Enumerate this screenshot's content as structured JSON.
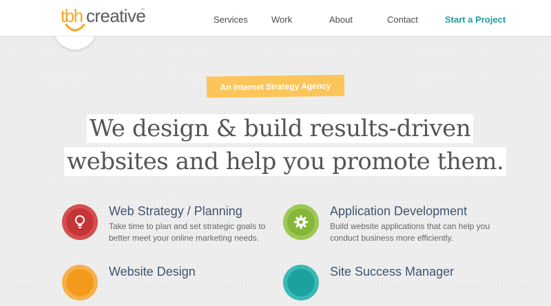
{
  "logo": {
    "prefix": "tbh",
    "name": "creative",
    "tm": "™"
  },
  "nav": {
    "items": [
      {
        "label": "Services"
      },
      {
        "label": "Work"
      },
      {
        "label": "About"
      },
      {
        "label": "Contact"
      }
    ],
    "cta": "Start a Project"
  },
  "hero": {
    "badge": "An Internet Strategy Agency",
    "headline_line1": "We design & build results-driven",
    "headline_line2": "websites and help you promote them."
  },
  "services": [
    {
      "title": "Web Strategy / Planning",
      "desc": "Take time to plan and set strategic goals to better meet your online marketing needs.",
      "icon": "lightbulb-icon",
      "color": "#c93a3a"
    },
    {
      "title": "Application Development",
      "desc": "Build website applications that can help you conduct business more efficiently.",
      "icon": "gear-icon",
      "color": "#8cbc3f"
    },
    {
      "title": "Website Design",
      "desc": "",
      "icon": "design-icon",
      "color": "#f5a124"
    },
    {
      "title": "Site Success Manager",
      "desc": "",
      "icon": "chart-icon",
      "color": "#1fa6a3"
    }
  ],
  "colors": {
    "brand_orange": "#f6a81d",
    "accent_teal": "#1f9aa2",
    "title_navy": "#3f5570",
    "badge_yellow": "#fcc55a"
  }
}
